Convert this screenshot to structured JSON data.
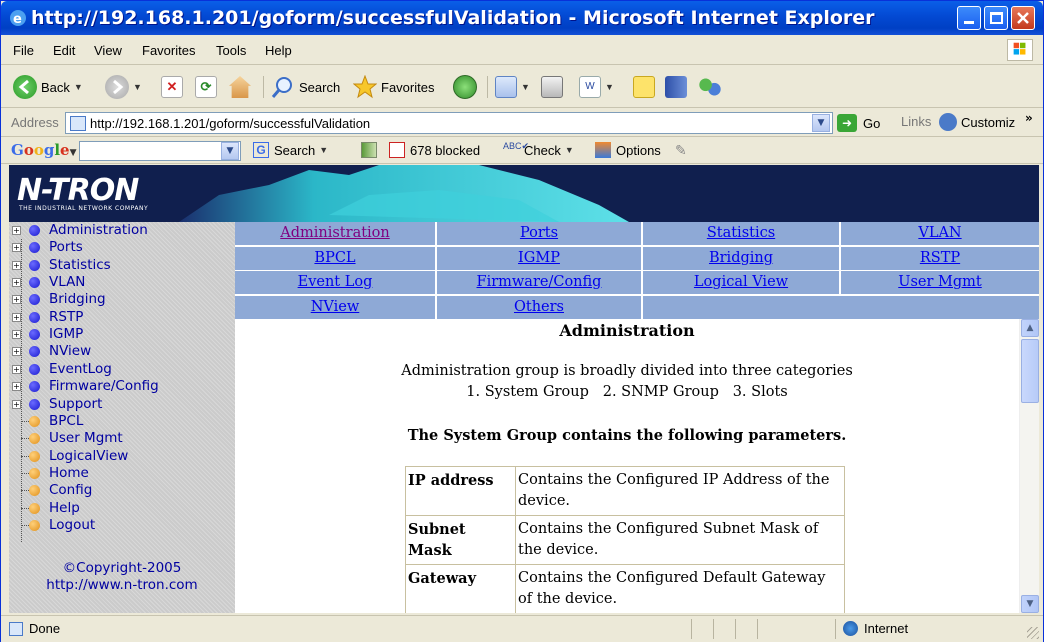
{
  "window": {
    "title": "http://192.168.1.201/goform/successfulValidation - Microsoft Internet Explorer"
  },
  "menu": [
    "File",
    "Edit",
    "View",
    "Favorites",
    "Tools",
    "Help"
  ],
  "toolbar": {
    "back": "Back",
    "search": "Search",
    "favorites": "Favorites"
  },
  "address": {
    "label": "Address",
    "url": "http://192.168.1.201/goform/successfulValidation",
    "go": "Go",
    "links": "Links",
    "customize": "Customiz"
  },
  "google": {
    "logo": "Google",
    "search": "Search",
    "blocked": "678 blocked",
    "check": "Check",
    "options": "Options"
  },
  "banner": {
    "logo": "N-TRON",
    "tagline": "THE INDUSTRIAL NETWORK COMPANY"
  },
  "sidebar": {
    "items": [
      {
        "label": "Administration",
        "expandable": true
      },
      {
        "label": "Ports",
        "expandable": true
      },
      {
        "label": "Statistics",
        "expandable": true
      },
      {
        "label": "VLAN",
        "expandable": true
      },
      {
        "label": "Bridging",
        "expandable": true
      },
      {
        "label": "RSTP",
        "expandable": true
      },
      {
        "label": "IGMP",
        "expandable": true
      },
      {
        "label": "NView",
        "expandable": true
      },
      {
        "label": "EventLog",
        "expandable": true
      },
      {
        "label": "Firmware/Config",
        "expandable": true
      },
      {
        "label": "Support",
        "expandable": true
      },
      {
        "label": "BPCL",
        "expandable": false
      },
      {
        "label": "User Mgmt",
        "expandable": false
      },
      {
        "label": "LogicalView",
        "expandable": false
      },
      {
        "label": "Home",
        "expandable": false
      },
      {
        "label": "Config",
        "expandable": false
      },
      {
        "label": "Help",
        "expandable": false
      },
      {
        "label": "Logout",
        "expandable": false
      }
    ],
    "copyright": "©Copyright-2005",
    "website": "http://www.n-tron.com"
  },
  "navgrid": {
    "rows": [
      [
        "Administration",
        "Ports",
        "Statistics",
        "VLAN"
      ],
      [
        "BPCL",
        "IGMP",
        "Bridging",
        "RSTP"
      ],
      [
        "Event Log",
        "Firmware/Config",
        "Logical View",
        "User Mgmt"
      ],
      [
        "NView",
        "Others",
        "",
        ""
      ]
    ]
  },
  "main": {
    "heading": "Administration",
    "intro": "Administration group is broadly divided into three categories",
    "categories": "1. System Group   2. SNMP Group   3. Slots",
    "subheading": "The System Group contains the following parameters.",
    "params": [
      {
        "name": "IP address",
        "desc": "Contains the Configured IP Address of the device."
      },
      {
        "name": "Subnet Mask",
        "desc": "Contains the Configured Subnet Mask of the device."
      },
      {
        "name": "Gateway",
        "desc": "Contains the Configured Default Gateway of the device."
      }
    ]
  },
  "status": {
    "text": "Done",
    "zone": "Internet"
  },
  "colors": {
    "titlebar": "#0349d3",
    "banner": "#101f4e",
    "navcell": "#8ea9d6",
    "sidebar": "#cbcbcb",
    "link": "#0000ee",
    "visited": "#800080",
    "bullet_blue": "#1a1ad0",
    "bullet_orange": "#e0901a"
  }
}
